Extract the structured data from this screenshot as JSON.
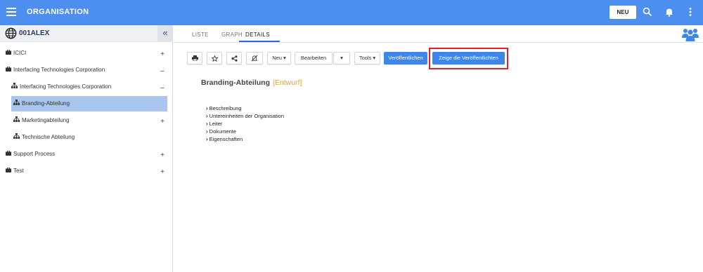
{
  "app": {
    "title": "ORGANISATION",
    "new_label": "NEU"
  },
  "colors": {
    "topbar": "#4c8ff0",
    "primary": "#3d86ec",
    "selected": "#a9c6ef",
    "status": "#f0a030",
    "highlight": "#e0202a"
  },
  "sidebar": {
    "title": "001ALEX",
    "collapse_glyph": "«",
    "items": [
      {
        "label": "ICICI",
        "icon": "briefcase-icon",
        "sign": "+"
      },
      {
        "label": "Interfacing Technologies Corporation",
        "icon": "briefcase-icon",
        "sign": "–"
      },
      {
        "label": "Interfacing Technologies Corporation",
        "icon": "org-chart-icon",
        "sign": "–"
      },
      {
        "label": "Branding-Abteilung",
        "icon": "org-chart-icon",
        "sign": "",
        "selected": true
      },
      {
        "label": "Marketingabteilung",
        "icon": "org-chart-icon",
        "sign": "+"
      },
      {
        "label": "Technische Abteilung",
        "icon": "org-chart-icon",
        "sign": ""
      },
      {
        "label": "Support Process",
        "icon": "briefcase-icon",
        "sign": "+"
      },
      {
        "label": "Test",
        "icon": "briefcase-icon",
        "sign": "+"
      }
    ]
  },
  "main": {
    "tabs": [
      {
        "label": "LISTE"
      },
      {
        "label": "GRAPH"
      },
      {
        "label": "DETAILS",
        "active": true
      }
    ],
    "toolbar": {
      "print_icon": "printer-icon",
      "favorite_icon": "star-icon",
      "share_icon": "share-icon",
      "unfollow_icon": "bell-off-icon",
      "new_label": "Neu ▾",
      "edit_label": "Bearbeiten",
      "edit_caret": "▾",
      "tools_label": "Tools ▾",
      "publish_label": "Veröffentlichen",
      "show_published_label": "Zeige die Veröffentlichten"
    },
    "record": {
      "title": "Branding-Abteilung",
      "status": "[Entwurf]"
    },
    "sections": [
      {
        "label": "Beschreibung"
      },
      {
        "label": "Untereinheiten der Organisation"
      },
      {
        "label": "Leiter"
      },
      {
        "label": "Dokumente"
      },
      {
        "label": "Eigenschaften"
      }
    ]
  }
}
